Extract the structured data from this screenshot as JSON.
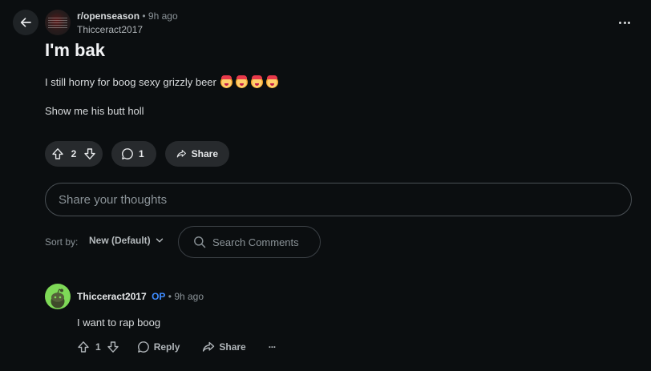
{
  "post": {
    "subreddit": "r/openseason",
    "separator": "•",
    "time": "9h ago",
    "author": "Thicceract2017",
    "title": "I'm bak",
    "body_line1": "I still horny for boog sexy grizzly beer",
    "emoji_count": 4,
    "body_line2": "Show me his butt holl",
    "vote_count": "2",
    "comment_count": "1",
    "share_label": "Share"
  },
  "composer": {
    "placeholder": "Share your thoughts"
  },
  "sort": {
    "label": "Sort by:",
    "selected": "New (Default)"
  },
  "search": {
    "placeholder": "Search Comments"
  },
  "comments": [
    {
      "author": "Thicceract2017",
      "badge": "OP",
      "separator": "•",
      "time": "9h ago",
      "body": "I want to rap boog",
      "vote_count": "1",
      "reply_label": "Reply",
      "share_label": "Share",
      "more_label": "···"
    }
  ],
  "colors": {
    "background": "#0b0e10",
    "pill": "#272a2d",
    "op_badge": "#3f8cff",
    "avatar_green": "#7ed957"
  }
}
